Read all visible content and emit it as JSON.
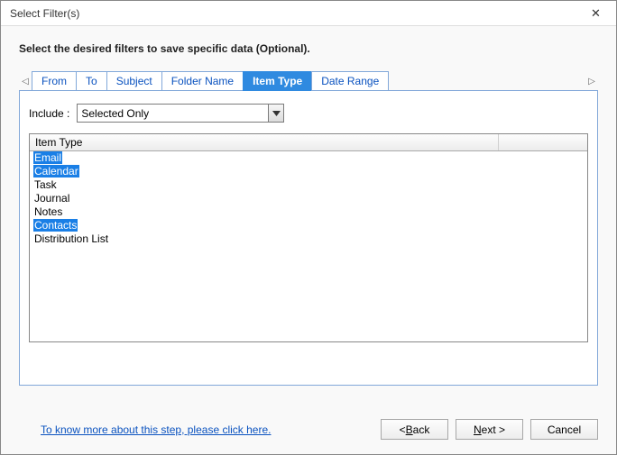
{
  "window": {
    "title": "Select Filter(s)"
  },
  "instruction": "Select the desired filters to save specific data (Optional).",
  "tabs": {
    "t0": "From",
    "t1": "To",
    "t2": "Subject",
    "t3": "Folder Name",
    "t4": "Item Type",
    "t5": "Date Range",
    "active_index": 4
  },
  "include": {
    "label": "Include :",
    "value": "Selected Only"
  },
  "list": {
    "column_header": "Item Type",
    "rows": [
      {
        "label": "Email",
        "selected": true
      },
      {
        "label": "Calendar",
        "selected": true
      },
      {
        "label": "Task",
        "selected": false
      },
      {
        "label": "Journal",
        "selected": false
      },
      {
        "label": "Notes",
        "selected": false
      },
      {
        "label": "Contacts",
        "selected": true
      },
      {
        "label": "Distribution List",
        "selected": false
      }
    ]
  },
  "footer": {
    "help_link": "To know more about this step, please click here.",
    "back_prefix": "< ",
    "back_u": "B",
    "back_suffix": "ack",
    "next_u": "N",
    "next_suffix": "ext >",
    "cancel": "Cancel"
  }
}
